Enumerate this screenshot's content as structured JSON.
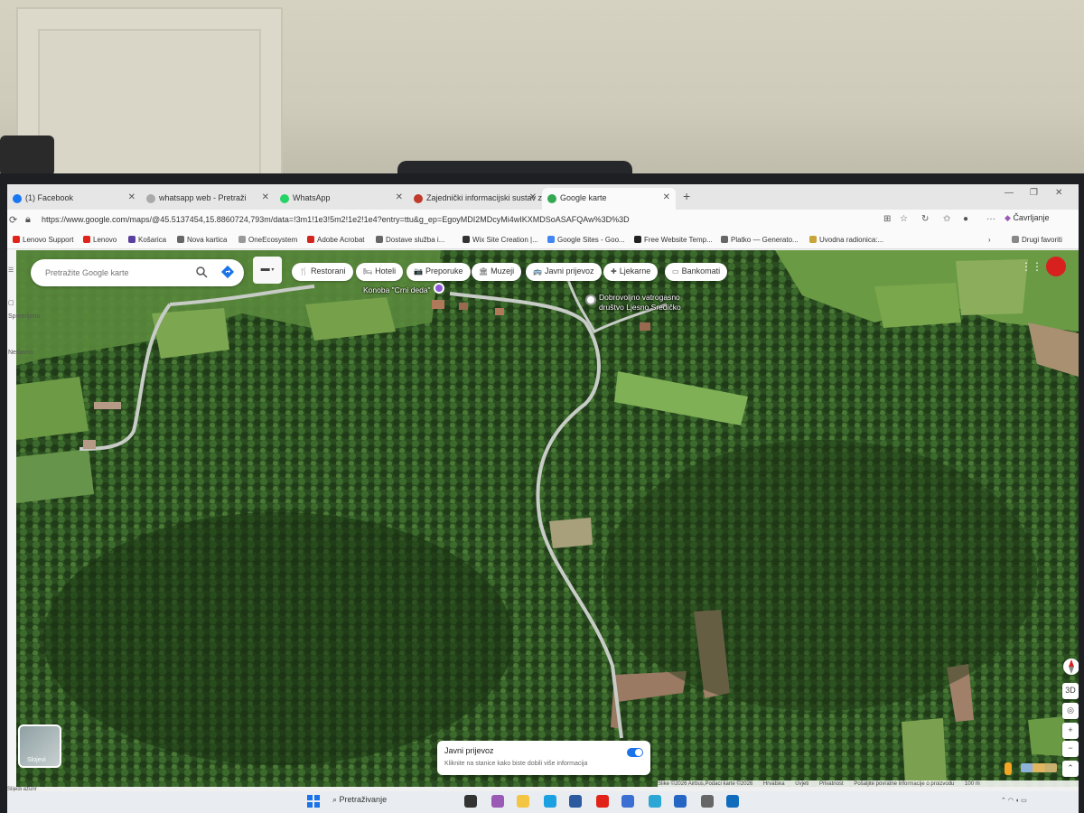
{
  "browser": {
    "tabs": [
      {
        "label": "(1) Facebook",
        "color": "#1877f2"
      },
      {
        "label": "whatsapp web - Pretraži",
        "color": "#aaaaaa"
      },
      {
        "label": "WhatsApp",
        "color": "#25d366"
      },
      {
        "label": "Zajednički informacijski sustav zem",
        "color": "#c0392b"
      },
      {
        "label": "Google karte",
        "color": "#34a853"
      }
    ],
    "url": "https://www.google.com/maps/@45.5137454,15.8860724,793m/data=!3m1!1e3!5m2!1e2!1e4?entry=ttu&g_ep=EgoyMDI2MDcyMi4wIKXMDSoASAFQAw%3D%3D",
    "profile_label": "Čavrljanje",
    "bookmarks": [
      {
        "label": "Lenovo Support",
        "color": "#e2231a"
      },
      {
        "label": "Lenovo",
        "color": "#e2231a"
      },
      {
        "label": "Košarica",
        "color": "#5b3fa0"
      },
      {
        "label": "Nova kartica",
        "color": "#666666"
      },
      {
        "label": "OneEcosystem",
        "color": "#999999"
      },
      {
        "label": "Adobe Acrobat",
        "color": "#d4241e"
      },
      {
        "label": "Dostave služba i...",
        "color": "#666666"
      },
      {
        "label": "Wix Site Creation |...",
        "color": "#333333"
      },
      {
        "label": "Google Sites - Goo...",
        "color": "#4285f4"
      },
      {
        "label": "Free Website Temp...",
        "color": "#222222"
      },
      {
        "label": "Platko — Generato...",
        "color": "#666666"
      },
      {
        "label": "Uvodna radionica:...",
        "color": "#c9a43a"
      }
    ],
    "other_bookmarks": "Drugi favoriti"
  },
  "maps": {
    "search_placeholder": "Pretražite Google karte",
    "chips": [
      {
        "label": "Restorani",
        "icon": "🍴"
      },
      {
        "label": "Hoteli",
        "icon": "🛏"
      },
      {
        "label": "Preporuke",
        "icon": "📷"
      },
      {
        "label": "Muzeji",
        "icon": "🏛"
      },
      {
        "label": "Javni prijevoz",
        "icon": "🚌"
      },
      {
        "label": "Ljekarne",
        "icon": "✚"
      },
      {
        "label": "Bankomati",
        "icon": "▭"
      }
    ],
    "places": {
      "konoba": "Konoba \"Crni deda\"",
      "dvd_line1": "Dobrovoljno vatrogasno",
      "dvd_line2": "društvo Ljesno Sredičko"
    },
    "layers_label": "Slojevi",
    "transit_card": {
      "title": "Javni prijevoz",
      "subtitle": "Kliknite na stanice kako biste dobili više informacija"
    },
    "controls": {
      "view_3d": "3D"
    },
    "footer": {
      "imagery": "Slike ©2026 Airbus,Podaci karte ©2026",
      "country": "Hrvatska",
      "terms": "Uvjeti",
      "privacy": "Privatnost",
      "feedback": "Pošaljite povratne informacije o proizvodu",
      "scale": "100 m"
    }
  },
  "left_rail": {
    "item1": "Spremljeno",
    "item2": "Nedavno"
  },
  "status_strip": "Slijedi ažurir",
  "taskbar": {
    "search_placeholder": "Pretraživanje",
    "apps": [
      {
        "name": "task-view",
        "color": "#333333"
      },
      {
        "name": "copilot",
        "color": "#9b59b6"
      },
      {
        "name": "file-explorer",
        "color": "#f4c542"
      },
      {
        "name": "edge",
        "color": "#1ba1e2"
      },
      {
        "name": "store",
        "color": "#2c5aa0"
      },
      {
        "name": "lenovo",
        "color": "#e2231a"
      },
      {
        "name": "vantage",
        "color": "#3b6fd4"
      },
      {
        "name": "photos",
        "color": "#2aa7d5"
      },
      {
        "name": "snipping",
        "color": "#2566c5"
      },
      {
        "name": "settings",
        "color": "#666666"
      },
      {
        "name": "outlook",
        "color": "#0f6cbd"
      }
    ]
  }
}
